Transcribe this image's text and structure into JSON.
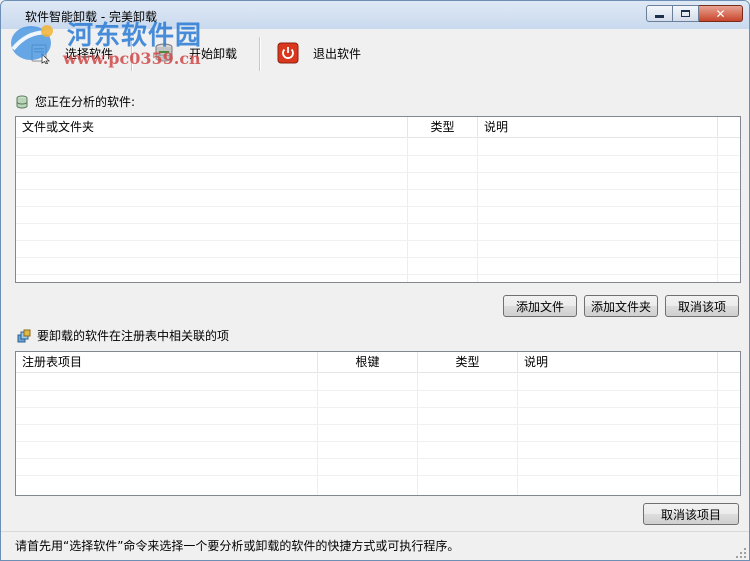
{
  "window": {
    "title": "软件智能卸载 - 完美卸载"
  },
  "watermark": {
    "site_name": "河东软件园",
    "url": "www.pc0359.cn"
  },
  "toolbar": {
    "select_label": "选择软件",
    "start_label": "开始卸载",
    "exit_label": "退出软件"
  },
  "analysis": {
    "label": "您正在分析的软件:",
    "columns": [
      "文件或文件夹",
      "类型",
      "说明"
    ],
    "add_file_label": "添加文件",
    "add_folder_label": "添加文件夹",
    "cancel_item_label": "取消该项"
  },
  "registry": {
    "label": "要卸载的软件在注册表中相关联的项",
    "columns": [
      "注册表项目",
      "根键",
      "类型",
      "说明"
    ],
    "cancel_item_label": "取消该项目"
  },
  "status": {
    "text": "请首先用“选择软件”命令来选择一个要分析或卸载的软件的快捷方式或可执行程序。"
  },
  "colors": {
    "title_gradient_top": "#dfe9f5",
    "close_button": "#c8452b",
    "watermark_blue": "#2a7bd5",
    "watermark_red": "#d04848",
    "exit_icon": "#d9381e"
  },
  "icons": {
    "app": "app-icon",
    "select": "select-software-icon",
    "start": "uninstall-disk-icon",
    "exit": "power-exit-icon",
    "analysis_section": "database-icon",
    "registry_section": "registry-icon"
  }
}
